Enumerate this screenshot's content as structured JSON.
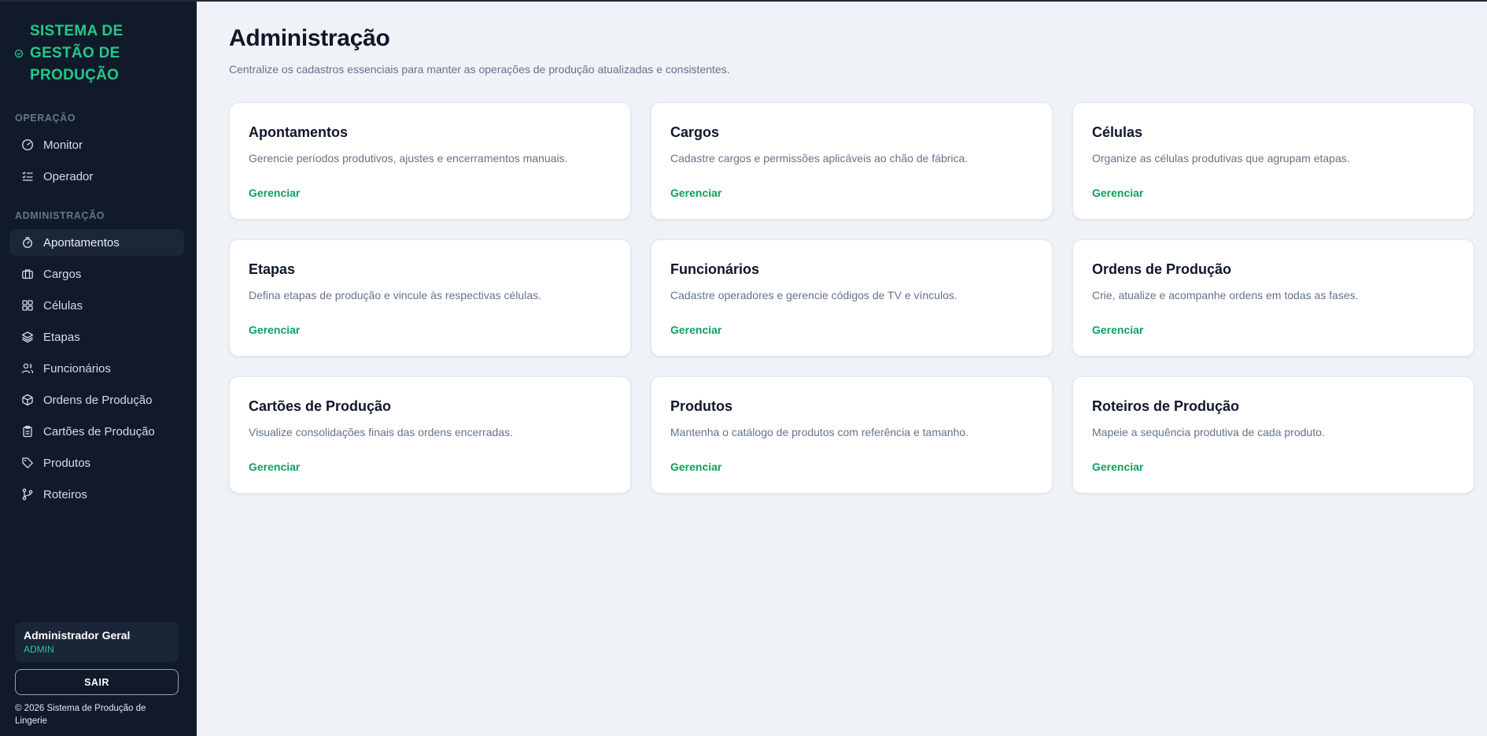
{
  "sidebar": {
    "brand": "SISTEMA DE GESTÃO DE PRODUÇÃO",
    "sections": {
      "operacao": "OPERAÇÃO",
      "administracao": "ADMINISTRAÇÃO"
    },
    "operation_items": [
      {
        "label": "Monitor",
        "icon": "gauge-icon"
      },
      {
        "label": "Operador",
        "icon": "list-check-icon"
      }
    ],
    "admin_items": [
      {
        "label": "Apontamentos",
        "icon": "timer-icon",
        "active": true
      },
      {
        "label": "Cargos",
        "icon": "briefcase-icon"
      },
      {
        "label": "Células",
        "icon": "grid-icon"
      },
      {
        "label": "Etapas",
        "icon": "layers-icon"
      },
      {
        "label": "Funcionários",
        "icon": "users-icon"
      },
      {
        "label": "Ordens de Produção",
        "icon": "package-icon"
      },
      {
        "label": "Cartões de Produção",
        "icon": "clipboard-icon"
      },
      {
        "label": "Produtos",
        "icon": "tag-icon"
      },
      {
        "label": "Roteiros",
        "icon": "git-branch-icon"
      }
    ],
    "user": {
      "name": "Administrador Geral",
      "role": "ADMIN"
    },
    "logout_label": "SAIR",
    "copyright": "© 2026 Sistema de Produção de Lingerie"
  },
  "header": {
    "title": "Administração",
    "subtitle": "Centralize os cadastros essenciais para manter as operações de produção atualizadas e consistentes."
  },
  "cards": [
    {
      "title": "Apontamentos",
      "description": "Gerencie períodos produtivos, ajustes e encerramentos manuais.",
      "link": "Gerenciar"
    },
    {
      "title": "Cargos",
      "description": "Cadastre cargos e permissões aplicáveis ao chão de fábrica.",
      "link": "Gerenciar"
    },
    {
      "title": "Células",
      "description": "Organize as células produtivas que agrupam etapas.",
      "link": "Gerenciar"
    },
    {
      "title": "Etapas",
      "description": "Defina etapas de produção e vincule às respectivas células.",
      "link": "Gerenciar"
    },
    {
      "title": "Funcionários",
      "description": "Cadastre operadores e gerencie códigos de TV e vínculos.",
      "link": "Gerenciar"
    },
    {
      "title": "Ordens de Produção",
      "description": "Crie, atualize e acompanhe ordens em todas as fases.",
      "link": "Gerenciar"
    },
    {
      "title": "Cartões de Produção",
      "description": "Visualize consolidações finais das ordens encerradas.",
      "link": "Gerenciar"
    },
    {
      "title": "Produtos",
      "description": "Mantenha o catálogo de produtos com referência e tamanho.",
      "link": "Gerenciar"
    },
    {
      "title": "Roteiros de Produção",
      "description": "Mapeie a sequência produtiva de cada produto.",
      "link": "Gerenciar"
    }
  ],
  "colors": {
    "sidebar_bg": "#111a2b",
    "accent_green": "#22c98a",
    "link_green": "#0e9f5e",
    "page_bg": "#eff2f7"
  }
}
